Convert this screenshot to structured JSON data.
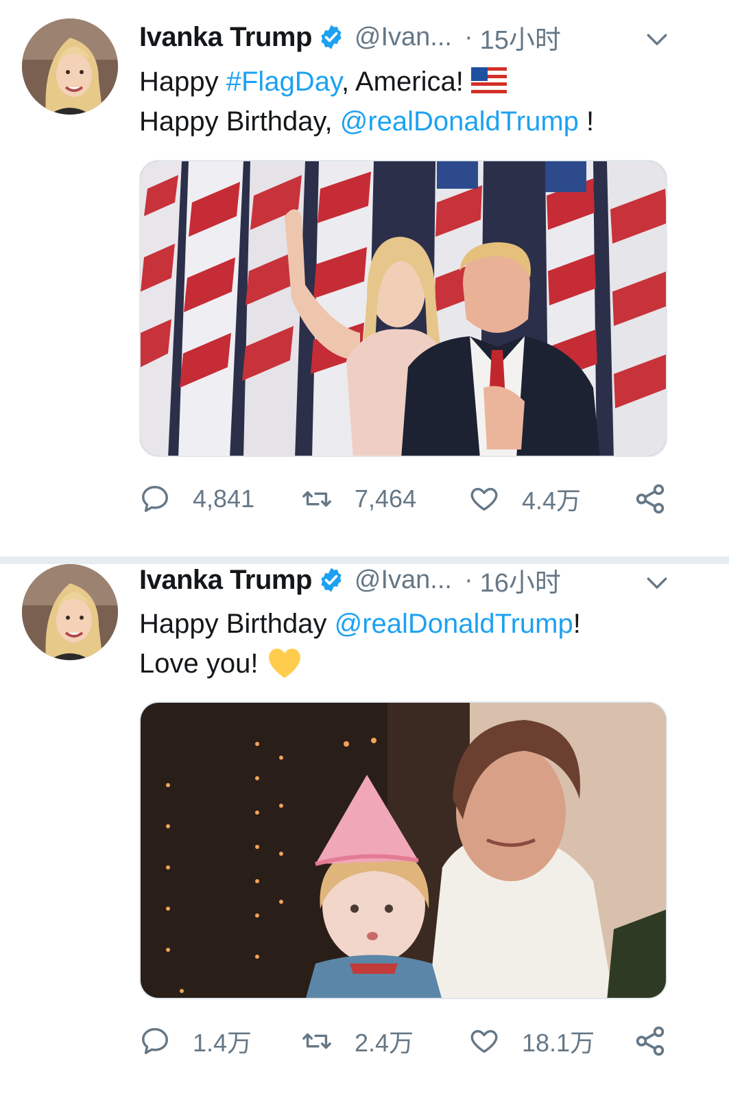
{
  "tweets": [
    {
      "author_name": "Ivanka Trump",
      "handle": "@Ivan...",
      "separator": "·",
      "time": "15小时",
      "text_line1_pre": "Happy ",
      "text_line1_hashtag": "#FlagDay",
      "text_line1_post": ", America! ",
      "text_line2_pre": "Happy Birthday, ",
      "text_line2_mention": "@realDonaldTrump",
      "text_line2_post": " !",
      "emoji": "us-flag-emoji",
      "media_description_icon": "photo",
      "reply_count": "4,841",
      "retweet_count": "7,464",
      "like_count": "4.4万"
    },
    {
      "author_name": "Ivanka Trump",
      "handle": "@Ivan...",
      "separator": "·",
      "time": "16小时",
      "text_line1_pre": "Happy Birthday ",
      "text_line1_mention": "@realDonaldTrump",
      "text_line1_post": "!",
      "text_line2_pre": "Love you! ",
      "emoji": "yellow-heart-emoji",
      "media_description_icon": "photo",
      "reply_count": "1.4万",
      "retweet_count": "2.4万",
      "like_count": "18.1万"
    }
  ],
  "colors": {
    "link": "#1da1f2",
    "secondary_text": "#657786",
    "verified_badge": "#1da1f2",
    "divider": "#e6ecf0",
    "heart_emoji": "#ffcc4d"
  }
}
